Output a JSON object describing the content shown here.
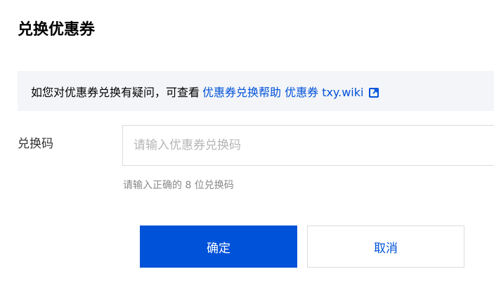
{
  "dialog": {
    "title": "兑换优惠券"
  },
  "notice": {
    "text": "如您对优惠券兑换有疑问，可查看",
    "help_link": "优惠券兑换帮助 优惠券 txy.wiki",
    "icon": "external-link-icon"
  },
  "form": {
    "code_label": "兑换码",
    "code_value": "",
    "code_placeholder": "请输入优惠券兑换码",
    "code_hint": "请输入正确的 8 位兑换码"
  },
  "actions": {
    "confirm_label": "确定",
    "cancel_label": "取消"
  },
  "colors": {
    "primary": "#0052d9",
    "notice_bg": "#f3f5f8",
    "border": "#dcdcdc"
  }
}
